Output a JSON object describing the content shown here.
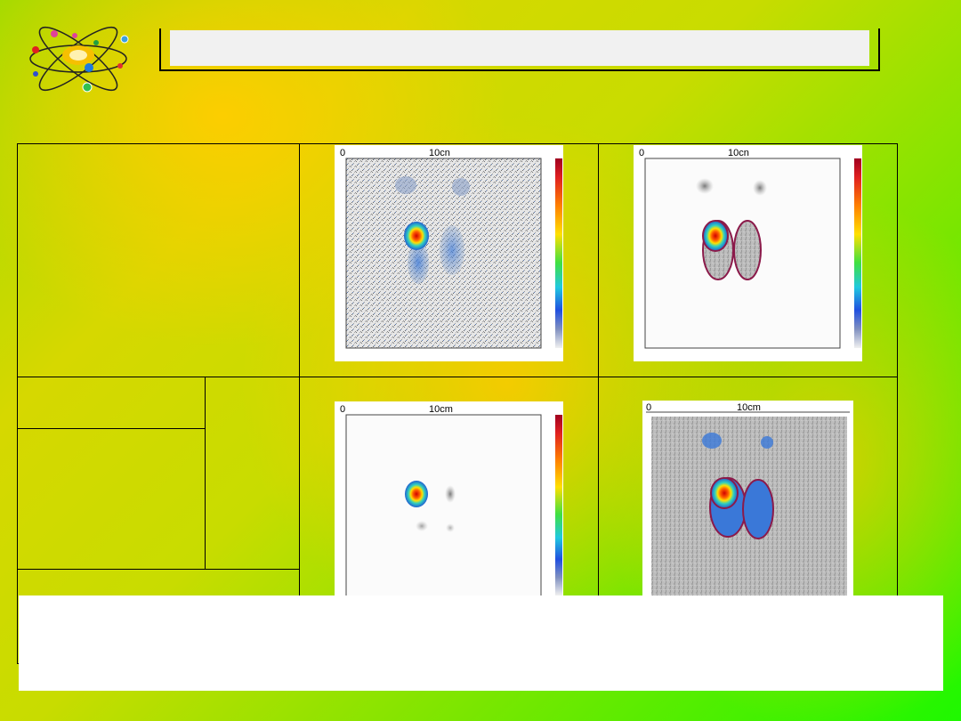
{
  "title": "",
  "caption": "",
  "table": {
    "left_cell_top": "",
    "left_cell_mid_a": "",
    "left_cell_mid_b": "",
    "left_cell_side": "",
    "left_cell_bottom": ""
  },
  "scans": [
    {
      "scale_zero": "0",
      "scale_label": "10cn"
    },
    {
      "scale_zero": "0",
      "scale_label": "10cn"
    },
    {
      "scale_zero": "0",
      "scale_label": "10cm"
    },
    {
      "scale_zero": "0",
      "scale_label": "10cm"
    }
  ],
  "colors": {
    "roi_outline": "#8b1a4a",
    "hot_spot": "#d40000",
    "uptake_blue": "#3a78d8"
  },
  "icons": [
    "atom-logo-icon"
  ]
}
